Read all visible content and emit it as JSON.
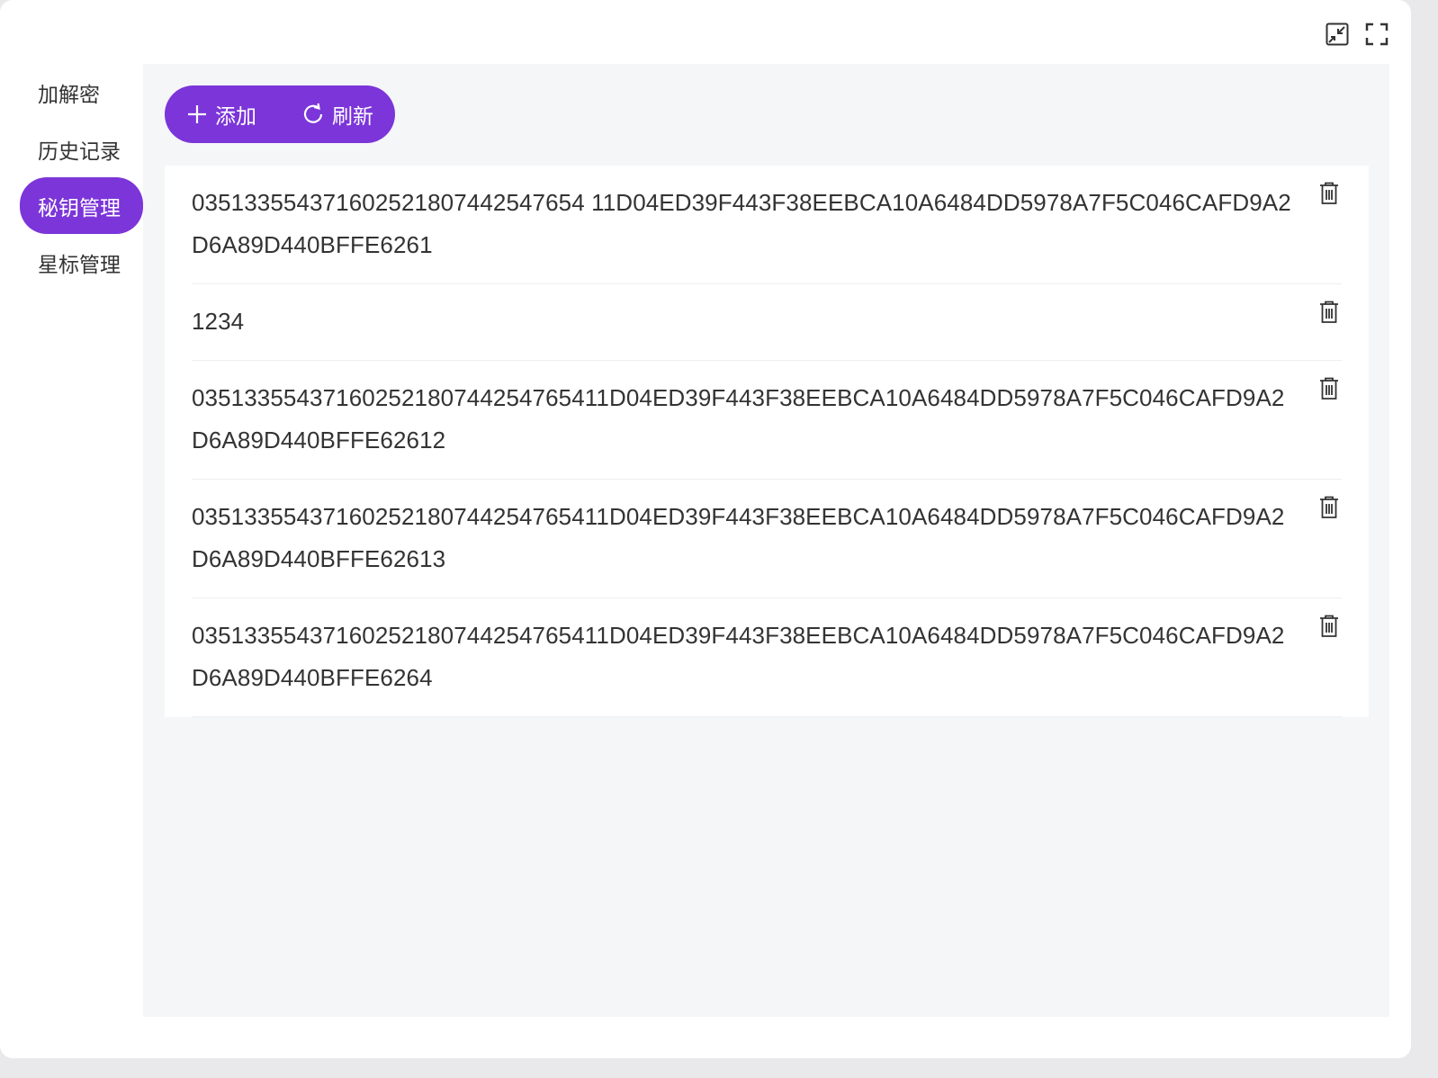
{
  "window_controls": {
    "shrink_icon": "shrink-window-icon",
    "fullscreen_icon": "fullscreen-icon"
  },
  "sidebar": {
    "items": [
      {
        "label": "加解密",
        "active": false
      },
      {
        "label": "历史记录",
        "active": false
      },
      {
        "label": "秘钥管理",
        "active": true
      },
      {
        "label": "星标管理",
        "active": false
      }
    ]
  },
  "toolbar": {
    "add_label": "添加",
    "refresh_label": "刷新",
    "accent_color": "#7b35d9"
  },
  "keys": [
    "035133554371602521807442547654 11D04ED39F443F38EEBCA10A6484DD5978A7F5C046CAFD9A2D6A89D440BFFE6261",
    "1234",
    "03513355437160252180744254765411D04ED39F443F38EEBCA10A6484DD5978A7F5C046CAFD9A2D6A89D440BFFE62612",
    "03513355437160252180744254765411D04ED39F443F38EEBCA10A6484DD5978A7F5C046CAFD9A2D6A89D440BFFE62613",
    "03513355437160252180744254765411D04ED39F443F38EEBCA10A6484DD5978A7F5C046CAFD9A2D6A89D440BFFE6264"
  ]
}
